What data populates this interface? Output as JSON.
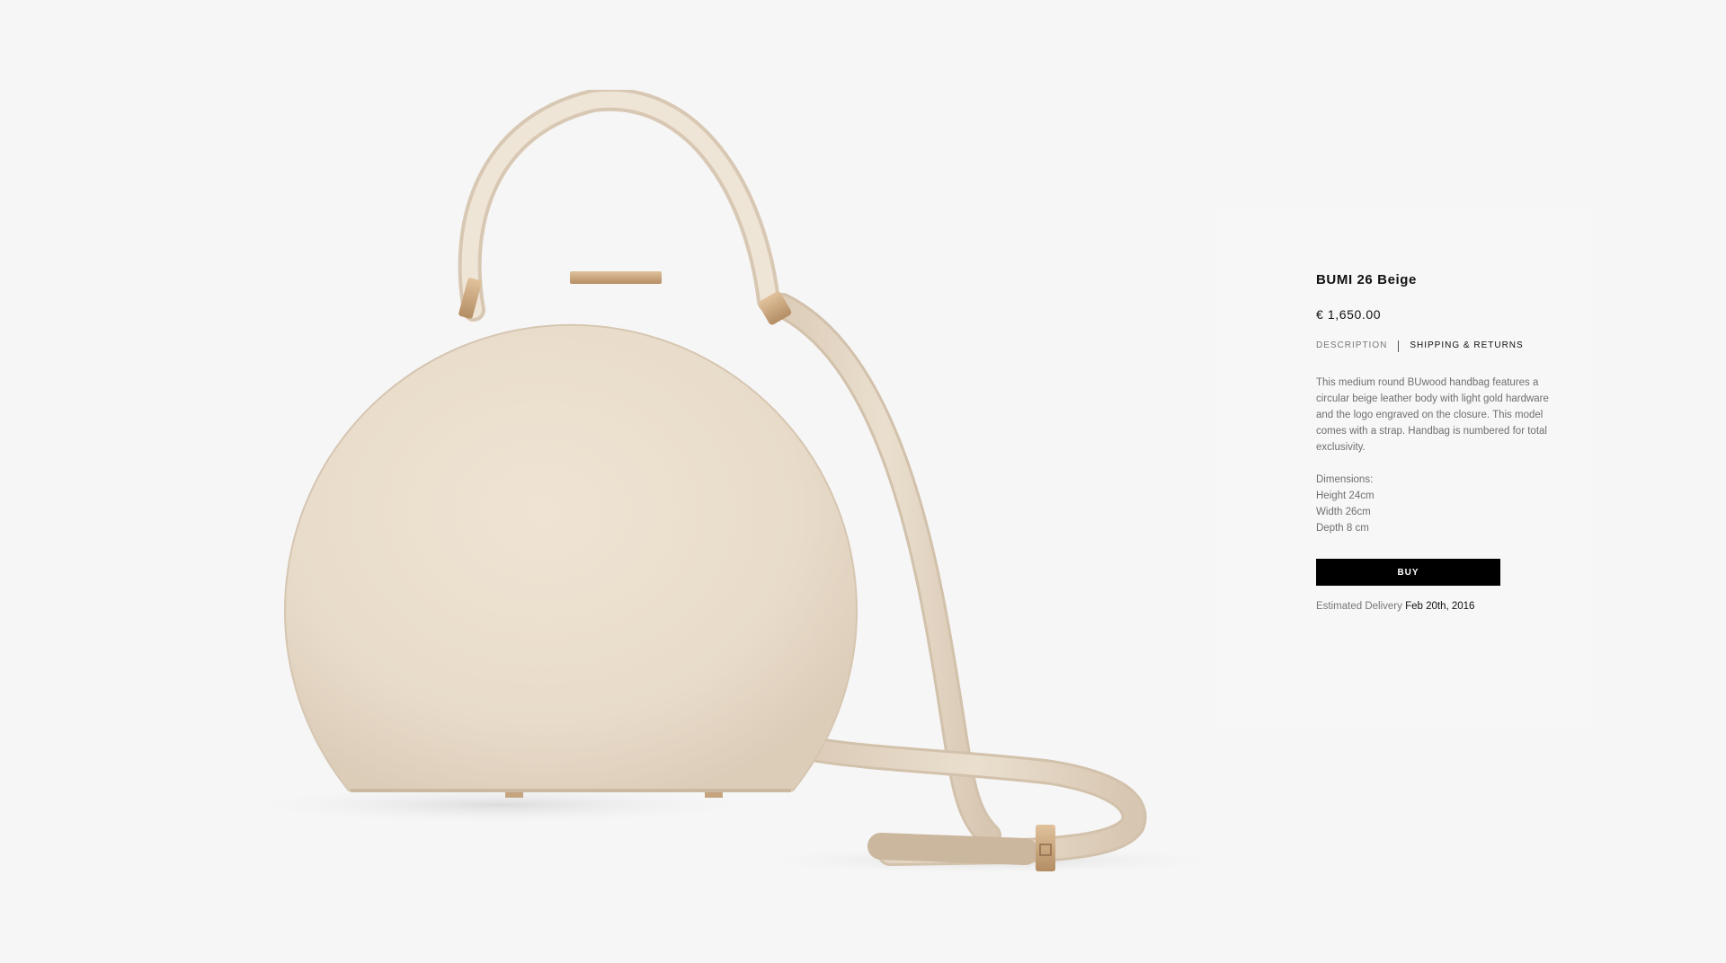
{
  "product": {
    "title": "BUMI 26 Beige",
    "price": "€ 1,650.00",
    "image_icon": "round-beige-handbag-image"
  },
  "tabs": [
    {
      "label": "DESCRIPTION",
      "active": false
    },
    {
      "label": "SHIPPING & RETURNS",
      "active": true
    }
  ],
  "description": "This medium round BUwood handbag features a circular beige leather body with light gold hardware and the logo engraved on the closure. This model comes with a strap. Handbag is numbered for total exclusivity.",
  "dimensions": {
    "heading": "Dimensions:",
    "height": "Height 24cm",
    "width": "Width 26cm",
    "depth": "Depth 8 cm"
  },
  "buy_label": "BUY",
  "delivery": {
    "label": "Estimated Delivery",
    "date": "Feb 20th, 2016"
  },
  "colors": {
    "background": "#f6f6f6",
    "leather": "#e9dccb",
    "hardware": "#c9a57e",
    "button": "#000000"
  }
}
